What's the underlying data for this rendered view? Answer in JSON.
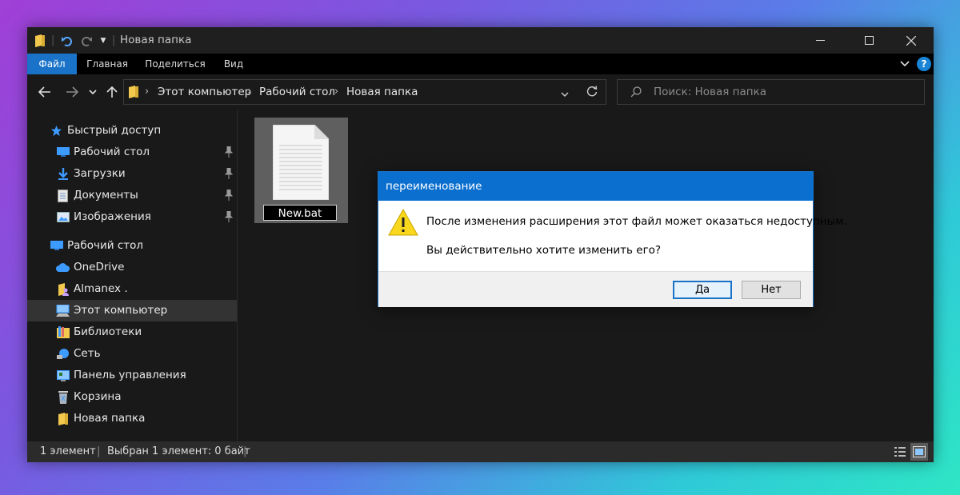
{
  "window": {
    "title": "Новая папка"
  },
  "ribbon": {
    "tabs": [
      {
        "label": "Файл",
        "active": true
      },
      {
        "label": "Главная",
        "active": false
      },
      {
        "label": "Поделиться",
        "active": false
      },
      {
        "label": "Вид",
        "active": false
      }
    ],
    "help_label": "?"
  },
  "address": {
    "crumbs": [
      "Этот компьютер",
      "Рабочий стол",
      "Новая папка"
    ]
  },
  "search": {
    "placeholder": "Поиск: Новая папка"
  },
  "sidebar": {
    "quick_access_label": "Быстрый доступ",
    "items": [
      {
        "label": "Быстрый доступ",
        "icon": "star-icon",
        "pinned": false
      },
      {
        "label": "Рабочий стол",
        "icon": "desktop-icon",
        "pinned": true
      },
      {
        "label": "Загрузки",
        "icon": "download-icon",
        "pinned": true
      },
      {
        "label": "Документы",
        "icon": "document-icon",
        "pinned": true
      },
      {
        "label": "Изображения",
        "icon": "image-icon",
        "pinned": true
      },
      {
        "label": "Рабочий стол",
        "icon": "desktop-icon",
        "pinned": false
      },
      {
        "label": "OneDrive",
        "icon": "cloud-icon",
        "pinned": false
      },
      {
        "label": "Almanex .",
        "icon": "user-folder-icon",
        "pinned": false
      },
      {
        "label": "Этот компьютер",
        "icon": "computer-icon",
        "pinned": false,
        "selected": true
      },
      {
        "label": "Библиотеки",
        "icon": "library-icon",
        "pinned": false
      },
      {
        "label": "Сеть",
        "icon": "network-icon",
        "pinned": false
      },
      {
        "label": "Панель управления",
        "icon": "control-panel-icon",
        "pinned": false
      },
      {
        "label": "Корзина",
        "icon": "recycle-bin-icon",
        "pinned": false
      },
      {
        "label": "Новая папка",
        "icon": "folder-icon",
        "pinned": false
      }
    ]
  },
  "content": {
    "file": {
      "name": "New.bat",
      "icon": "file-icon"
    }
  },
  "status": {
    "count": "1 элемент",
    "selected": "Выбран 1 элемент: 0 байт"
  },
  "dialog": {
    "title": "переименование",
    "message_line1": "После изменения расширения этот файл может оказаться недоступным.",
    "message_line2": "Вы действительно хотите изменить его?",
    "yes_label": "Да",
    "no_label": "Нет",
    "icon": "warning-icon"
  },
  "colors": {
    "accent": "#1a73c8",
    "dialog_title_bg": "#0a6fcf",
    "window_bg": "#191919",
    "folder": "#f2c94c"
  }
}
